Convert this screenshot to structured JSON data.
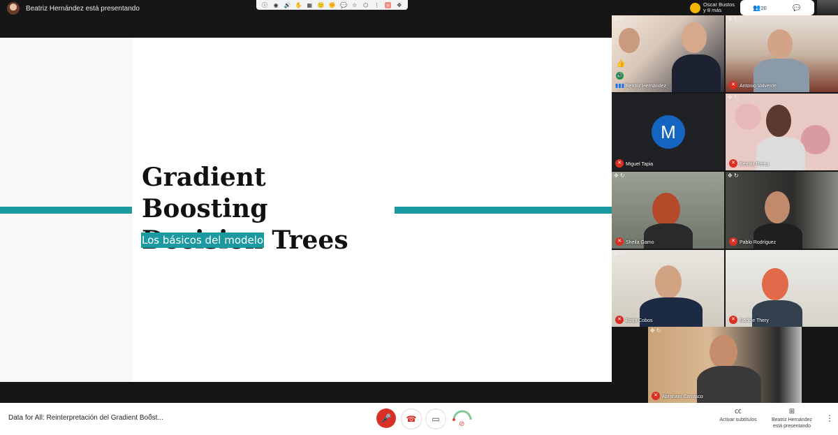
{
  "top_bar": {
    "presenting_label": "Beatriz Hernández está presentando",
    "extension_icons": [
      "ⓘ",
      "◉",
      "🔊",
      "✋",
      "▦",
      "🙂",
      "✊",
      "💬",
      "☆",
      "⬡",
      "⋮",
      "»",
      "✥"
    ],
    "participants_label_1": "Oscar Bustos",
    "participants_label_2": "y 8 más",
    "people_count": "20",
    "people_icon": "people-icon",
    "chat_icon": "chat-icon"
  },
  "slide": {
    "title_line1": "Gradient Boosting",
    "title_line2": "Decision Trees",
    "subtitle": "Los básicos del modelo",
    "accent_color": "#1a9aa0"
  },
  "participants": [
    {
      "name": "Beatriz Hernández",
      "mic": "on"
    },
    {
      "name": "Antonio Valverde",
      "mic": "off"
    },
    {
      "name": "Miguel Tapia",
      "mic": "off",
      "avatar_letter": "M"
    },
    {
      "name": "Beatriz Perea",
      "mic": "off"
    },
    {
      "name": "Sheila Gamo",
      "mic": "off"
    },
    {
      "name": "Pablo Rodríguez",
      "mic": "off"
    },
    {
      "name": "Borja Cobos",
      "mic": "off"
    },
    {
      "name": "Nadine Thery",
      "mic": "off"
    },
    {
      "name": "Abraham Carrasco",
      "mic": "off"
    }
  ],
  "bottom_bar": {
    "meeting_title": "Data for All: Reinterpretación del Gradient Boost...",
    "captions_label": "Activar subtítulos",
    "presenting_line1": "Beatriz Hernández",
    "presenting_line2": "está presentando"
  }
}
